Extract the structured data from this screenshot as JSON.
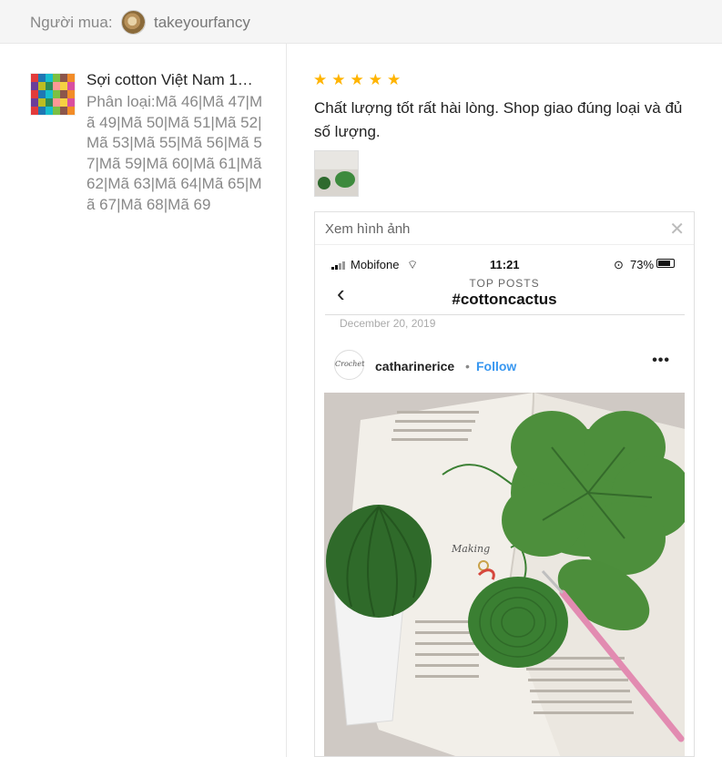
{
  "header": {
    "buyer_label": "Người mua:",
    "buyer_name": "takeyourfancy"
  },
  "product": {
    "name": "Sợi cotton Việt Nam 1…",
    "variant": "Phân loại:Mã 46|Mã 47|Mã 49|Mã 50|Mã 51|Mã 52|Mã 53|Mã 55|Mã 56|Mã 57|Mã 59|Mã 60|Mã 61|Mã 62|Mã 63|Mã 64|Mã 65|Mã 67|Mã 68|Mã 69"
  },
  "review": {
    "stars": "★★★★★",
    "text": "Chất lượng tốt rất hài lòng. Shop giao đúng loại và đủ số lượng."
  },
  "viewer": {
    "title": "Xem hình ảnh",
    "close": "✕"
  },
  "instagram": {
    "carrier": "Mobifone",
    "time": "11:21",
    "battery": "73%",
    "back": "‹",
    "section": "TOP POSTS",
    "hashtag": "#cottoncactus",
    "date": "December 20, 2019",
    "avatar_text": "Crochet",
    "username": "catharinerice",
    "dot": "•",
    "follow": "Follow",
    "more": "•••"
  },
  "colors": {
    "star": "#ffb400",
    "follow": "#3897f0",
    "yarn_green": "#3a7f32"
  }
}
